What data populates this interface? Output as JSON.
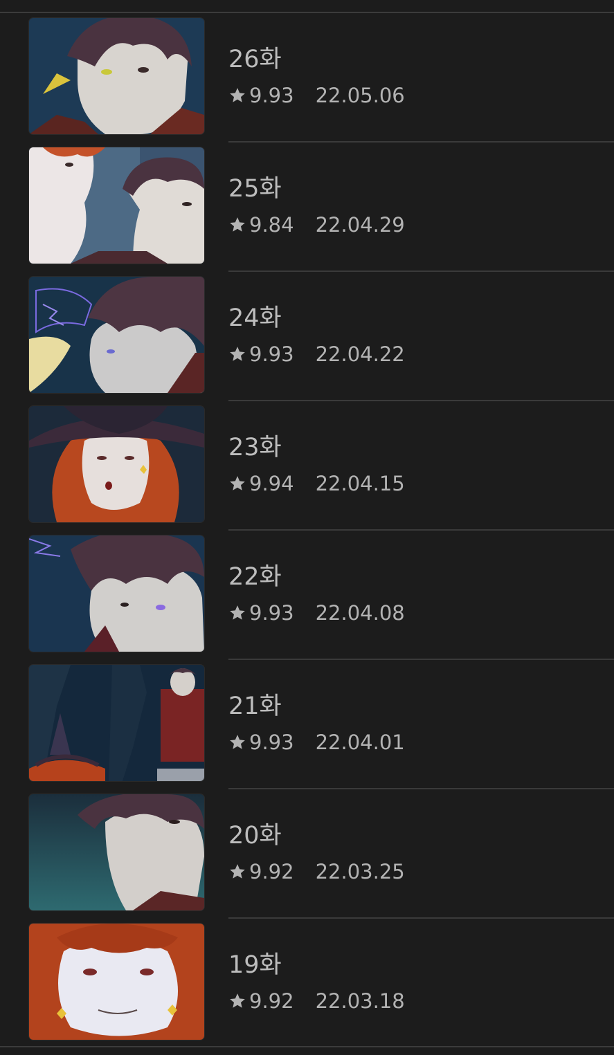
{
  "episodes": [
    {
      "title": "26화",
      "rating": "9.93",
      "date": "22.05.06",
      "thumbnail": "man-closeup-yellow-spark"
    },
    {
      "title": "25화",
      "rating": "9.84",
      "date": "22.04.29",
      "thumbnail": "redhead-woman-and-man"
    },
    {
      "title": "24화",
      "rating": "9.93",
      "date": "22.04.22",
      "thumbnail": "man-profile-purple-lightning"
    },
    {
      "title": "23화",
      "rating": "9.94",
      "date": "22.04.15",
      "thumbnail": "witch-redhead-hat"
    },
    {
      "title": "22화",
      "rating": "9.93",
      "date": "22.04.08",
      "thumbnail": "man-glowing-purple-eye"
    },
    {
      "title": "21화",
      "rating": "9.93",
      "date": "22.04.01",
      "thumbnail": "cave-man-and-witch"
    },
    {
      "title": "20화",
      "rating": "9.92",
      "date": "22.03.25",
      "thumbnail": "man-face-teal-background"
    },
    {
      "title": "19화",
      "rating": "9.92",
      "date": "22.03.18",
      "thumbnail": "redhead-woman-smiling"
    }
  ],
  "colors": {
    "background": "#1c1c1c",
    "divider": "#3a3a3a",
    "text": "#bdbdbd"
  }
}
